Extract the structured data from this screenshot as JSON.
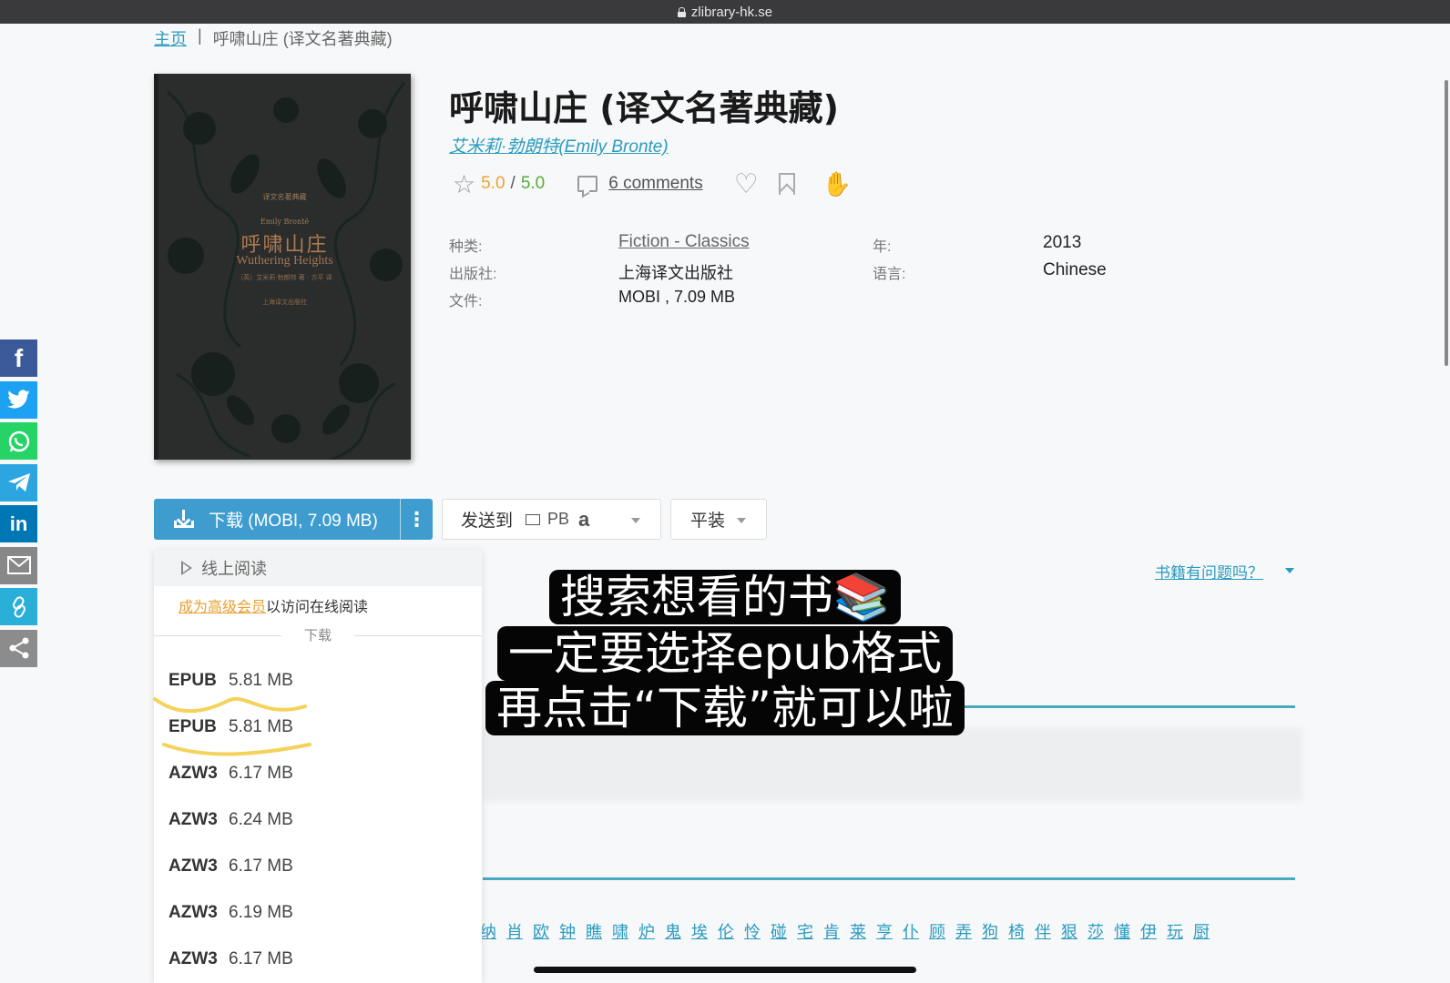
{
  "browser": {
    "url": "zlibrary-hk.se"
  },
  "breadcrumb": {
    "home": "主页",
    "separator": "|",
    "current": "呼啸山庄 (译文名著典藏)"
  },
  "cover": {
    "series": "译文名著典藏",
    "author": "Emily Brontë",
    "title_cn": "呼啸山庄",
    "title_en": "Wuthering Heights",
    "translator": "（英）艾米莉·勃朗特 著 · 方平 译",
    "publisher": "上海译文出版社"
  },
  "book": {
    "title": "呼啸山庄 (译文名著典藏)",
    "author": "艾米莉·勃朗特(Emily Bronte)",
    "rating": "5.0",
    "rating_sep": "/",
    "rating_max": "5.0",
    "comments": "6 comments"
  },
  "properties": {
    "category_label": "种类:",
    "category": "Fiction - Classics",
    "year_label": "年:",
    "year": "2013",
    "publisher_label": "出版社:",
    "publisher": "上海译文出版社",
    "language_label": "语言:",
    "language": "Chinese",
    "file_label": "文件:",
    "file": "MOBI , 7.09 MB"
  },
  "actions": {
    "download": "下载 (MOBI, 7.09 MB)",
    "more": "⋮",
    "send_to": "发送到",
    "pb": "PB",
    "amazon": "a",
    "binding": "平装",
    "issue": "书籍有问题吗？"
  },
  "dropdown": {
    "read_online": "线上阅读",
    "premium_link": "成为高级会员",
    "premium_text": "以访问在线阅读",
    "download_header": "下载",
    "items": [
      {
        "format": "EPUB",
        "size": "5.81 MB"
      },
      {
        "format": "EPUB",
        "size": "5.81 MB"
      },
      {
        "format": "AZW3",
        "size": "6.17 MB"
      },
      {
        "format": "AZW3",
        "size": "6.24 MB"
      },
      {
        "format": "AZW3",
        "size": "6.17 MB"
      },
      {
        "format": "AZW3",
        "size": "6.19 MB"
      },
      {
        "format": "AZW3",
        "size": "6.17 MB"
      }
    ]
  },
  "caption": {
    "line1": "搜索想看的书📚",
    "line2": "一定要选择epub格式",
    "line3": "再点击“下载”就可以啦"
  },
  "char_links": [
    "纳",
    "肖",
    "欧",
    "钟",
    "瞧",
    "啸",
    "炉",
    "鬼",
    "埃",
    "伦",
    "怜",
    "碰",
    "宅",
    "肯",
    "莱",
    "亨",
    "仆",
    "顾",
    "弄",
    "狗",
    "椅",
    "伴",
    "狠",
    "莎",
    "懂",
    "伊",
    "玩",
    "厨"
  ],
  "social": {
    "facebook": "f",
    "linkedin": "in"
  }
}
